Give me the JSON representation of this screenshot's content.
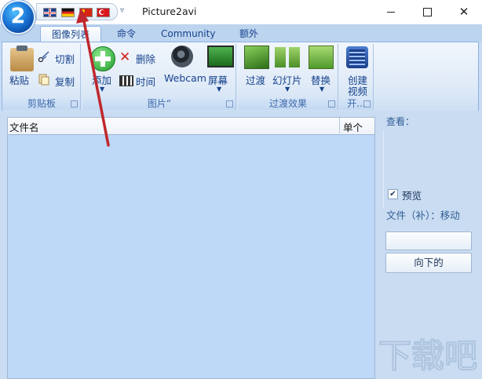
{
  "window": {
    "title": "Picture2avi",
    "app_logo_text": "2",
    "qat_dropdown": "▿",
    "controls": {
      "minimize": "",
      "maximize": "",
      "close": "✕"
    }
  },
  "language_flags": [
    "flag-uk-icon",
    "flag-germany-icon",
    "flag-china-icon",
    "flag-turkey-icon"
  ],
  "tabs": [
    {
      "label": "图像列表",
      "active": true
    },
    {
      "label": "命令",
      "active": false
    },
    {
      "label": "Community",
      "active": false
    },
    {
      "label": "额外",
      "active": false
    }
  ],
  "ribbon": {
    "clipboard": {
      "caption": "剪贴板",
      "paste": "粘贴",
      "cut": "切割",
      "copy": "复制"
    },
    "pictures": {
      "caption": "图片“",
      "add": "添加",
      "delete": "删除",
      "time": "时间",
      "webcam": "Webcam",
      "screen": "屏幕"
    },
    "transitions": {
      "caption": "过渡效果",
      "fade": "过渡",
      "slideshow": "幻灯片",
      "replace": "替换"
    },
    "start": {
      "caption": "开...",
      "create_video_line1": "创建",
      "create_video_line2": "视频"
    }
  },
  "file_list": {
    "columns": [
      "文件名",
      "单个"
    ]
  },
  "side_panel": {
    "view_label": "查看：",
    "preview_checkbox": {
      "label": "预览",
      "checked": true,
      "mark": "✔"
    },
    "file_status": "文件（补）：移动",
    "empty_button_label": "",
    "down_button": "向下的"
  },
  "watermark_text": "下载吧",
  "colors": {
    "accent": "#15428b",
    "list_background": "#bed8f8",
    "annotation_arrow": "#c0272d"
  }
}
